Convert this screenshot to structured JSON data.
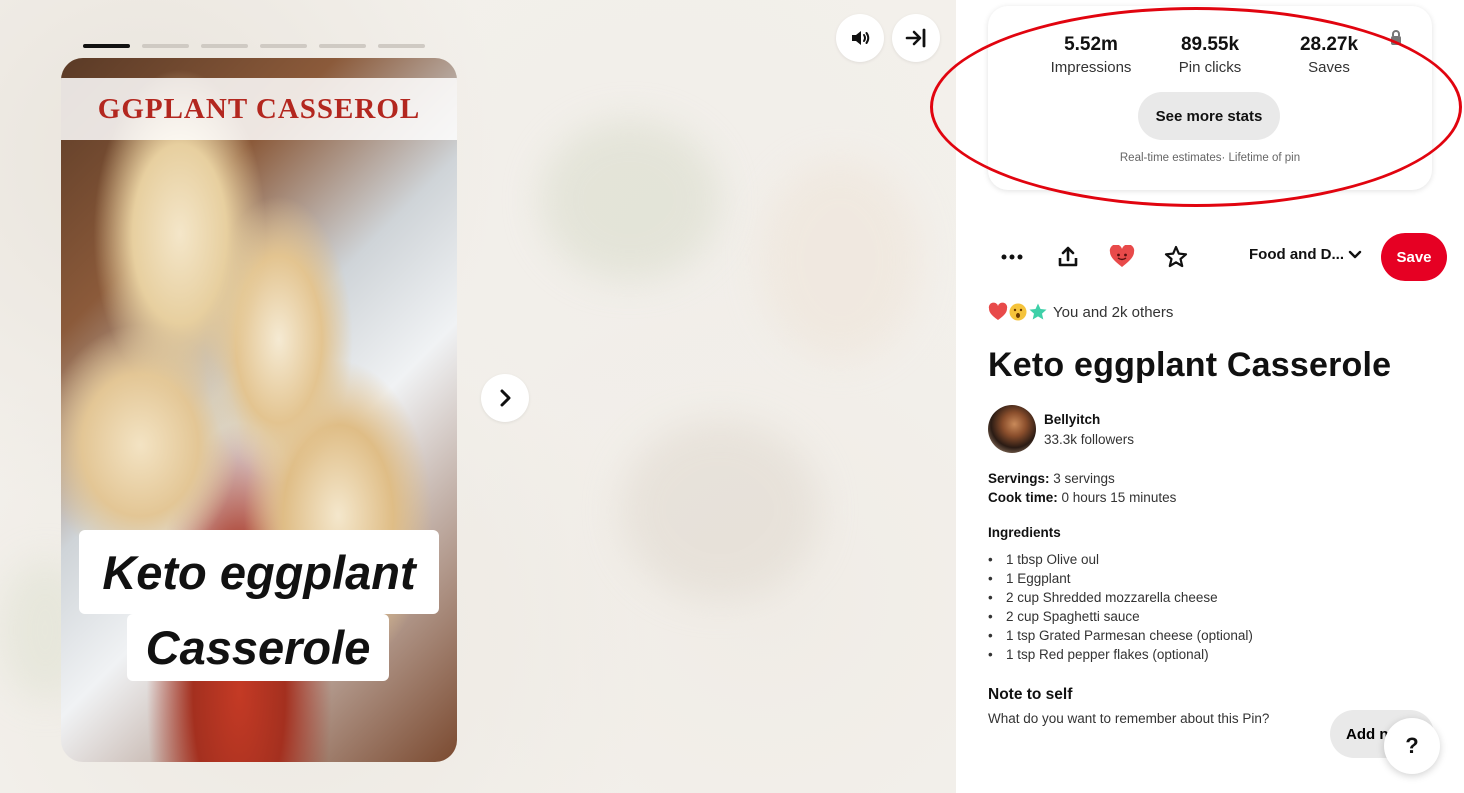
{
  "story": {
    "banner_text": "GGPLANT CASSEROL",
    "caption_line1": "Keto eggplant",
    "caption_line2": "Casserole",
    "segments": 6,
    "active_segment": 1
  },
  "controls": {
    "sound_icon": "speaker-icon",
    "collapse_icon": "collapse-right-icon",
    "next_icon": "chevron-right-icon"
  },
  "stats": {
    "impressions_value": "5.52m",
    "impressions_label": "Impressions",
    "clicks_value": "89.55k",
    "clicks_label": "Pin clicks",
    "saves_value": "28.27k",
    "saves_label": "Saves",
    "see_more_label": "See more stats",
    "estimates_note": "Real-time estimates· Lifetime of pin"
  },
  "actions": {
    "board_name": "Food and D...",
    "save_label": "Save"
  },
  "reactions_text": "You and 2k others",
  "pin": {
    "title": "Keto eggplant Casserole",
    "creator_name": "Bellyitch",
    "creator_followers": "33.3k followers",
    "servings_label": "Servings:",
    "servings_value": " 3 servings",
    "cook_time_label": "Cook time:",
    "cook_time_value": " 0 hours 15 minutes",
    "ingredients_heading": "Ingredients",
    "ingredients": [
      "1 tbsp Olive oul",
      "1 Eggplant",
      "2 cup Shredded mozzarella cheese",
      "2 cup Spaghetti sauce",
      "1 tsp Grated Parmesan cheese (optional)",
      "1 tsp Red pepper flakes (optional)"
    ],
    "note_heading": "Note to self",
    "note_prompt": "What do you want to remember about this Pin?",
    "add_note_label": "Add note"
  },
  "help_label": "?",
  "colors": {
    "save_red": "#e60023",
    "highlight_red": "#e1040f",
    "banner_red": "#b3271f"
  }
}
